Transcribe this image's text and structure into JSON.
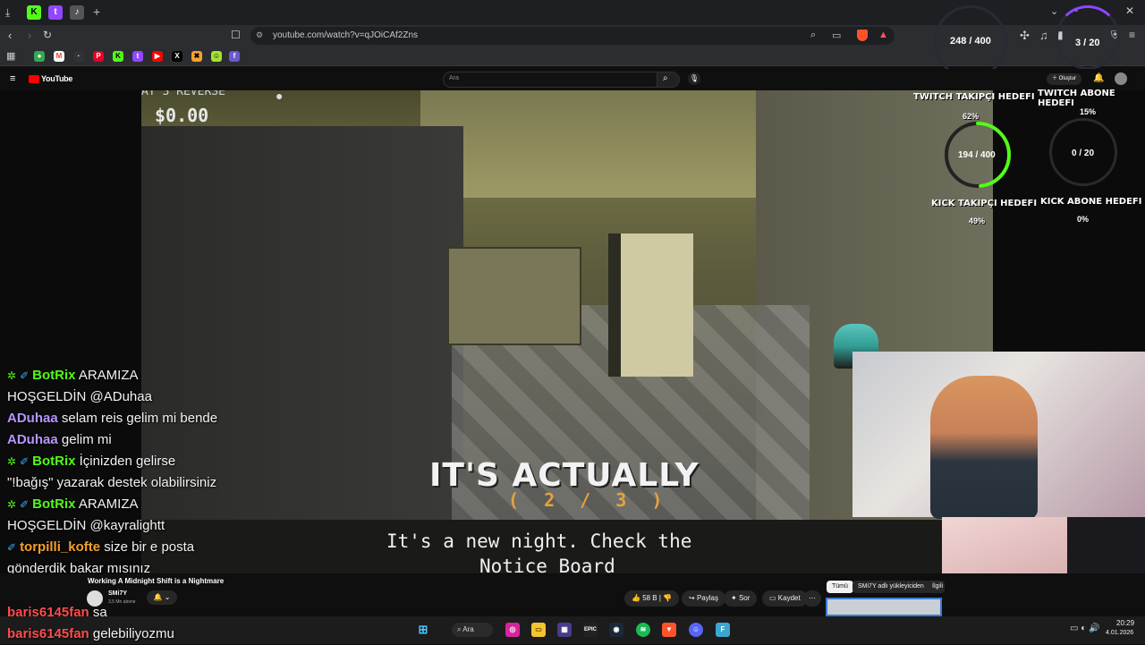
{
  "browser": {
    "url": "youtube.com/watch?v=qJOiCAf2Zns",
    "follower_counter": "248 / 400",
    "sub_counter": "3 / 20"
  },
  "youtube": {
    "logo": "YouTube",
    "search_placeholder": "Ara",
    "create_label": "Oluştur"
  },
  "game": {
    "reverse_label": "AT 3 REVERSE",
    "money": "$0.00",
    "caption": "IT'S ACTUALLY",
    "counter": "( 2 / 3 )",
    "subtitle_line1": "It's a new night. Check the",
    "subtitle_line2": "Notice Board"
  },
  "goals": {
    "twitch_follow_title": "TWITCH TAKIPÇI HEDEFI",
    "twitch_follow_pct": "62%",
    "kick_follow_ring": "194 / 400",
    "kick_follow_title": "KICK TAKIPÇI HEDEFI",
    "kick_follow_pct": "49%",
    "twitch_sub_title": "TWITCH ABONE HEDEFI",
    "twitch_sub_pct": "15%",
    "kick_sub_ring": "0 / 20",
    "kick_sub_title": "KICK ABONE HEDEFI",
    "kick_sub_pct": "0%",
    "kick_follow_fraction": 0.485
  },
  "chat": {
    "l1_user": "BotRix",
    "l1_text": "ARAMIZA",
    "l2_text": "HOŞGELDİN @ADuhaa",
    "l3_user": "ADuhaa",
    "l3_text": "selam reis gelim mi bende",
    "l4_user": "ADuhaa",
    "l4_text": "gelim mi",
    "l5_user": "BotRix",
    "l5_text": "İçinizden gelirse",
    "l6_text": "\"!bağış\" yazarak destek olabilirsiniz",
    "l7_user": "BotRix",
    "l7_text": "ARAMIZA",
    "l8_text": "HOŞGELDİN @kayralightt",
    "l9_user": "torpilli_kofte",
    "l9_text": "size bir e posta",
    "l10_text": "gönderdik bakar mısınız",
    "l11_user": "baris6145fan",
    "l11_text": "sa",
    "l12_user": "baris6145fan",
    "l12_text": "gelebiliyozmu"
  },
  "video_meta": {
    "title": "Working A Midnight Shift is a Nightmare",
    "channel": "SMi7Y",
    "subs": "3,5 Mn abone",
    "likes": "58 B",
    "share": "Paylaş",
    "ask": "Sor",
    "save": "Kaydet",
    "chip_all": "Tümü",
    "chip_channel": "SMi7Y adlı yükleyiciden",
    "chip_related": "İlgili"
  },
  "taskbar": {
    "search": "Ara",
    "clock_time": "20:29",
    "clock_date": "4.01.2026"
  },
  "colors": {
    "accent_green": "#53fc18",
    "bot_green": "#53fc18",
    "user_purple": "#b596ff",
    "user_orange": "#f4a12c",
    "user_red": "#ff4d4d"
  }
}
